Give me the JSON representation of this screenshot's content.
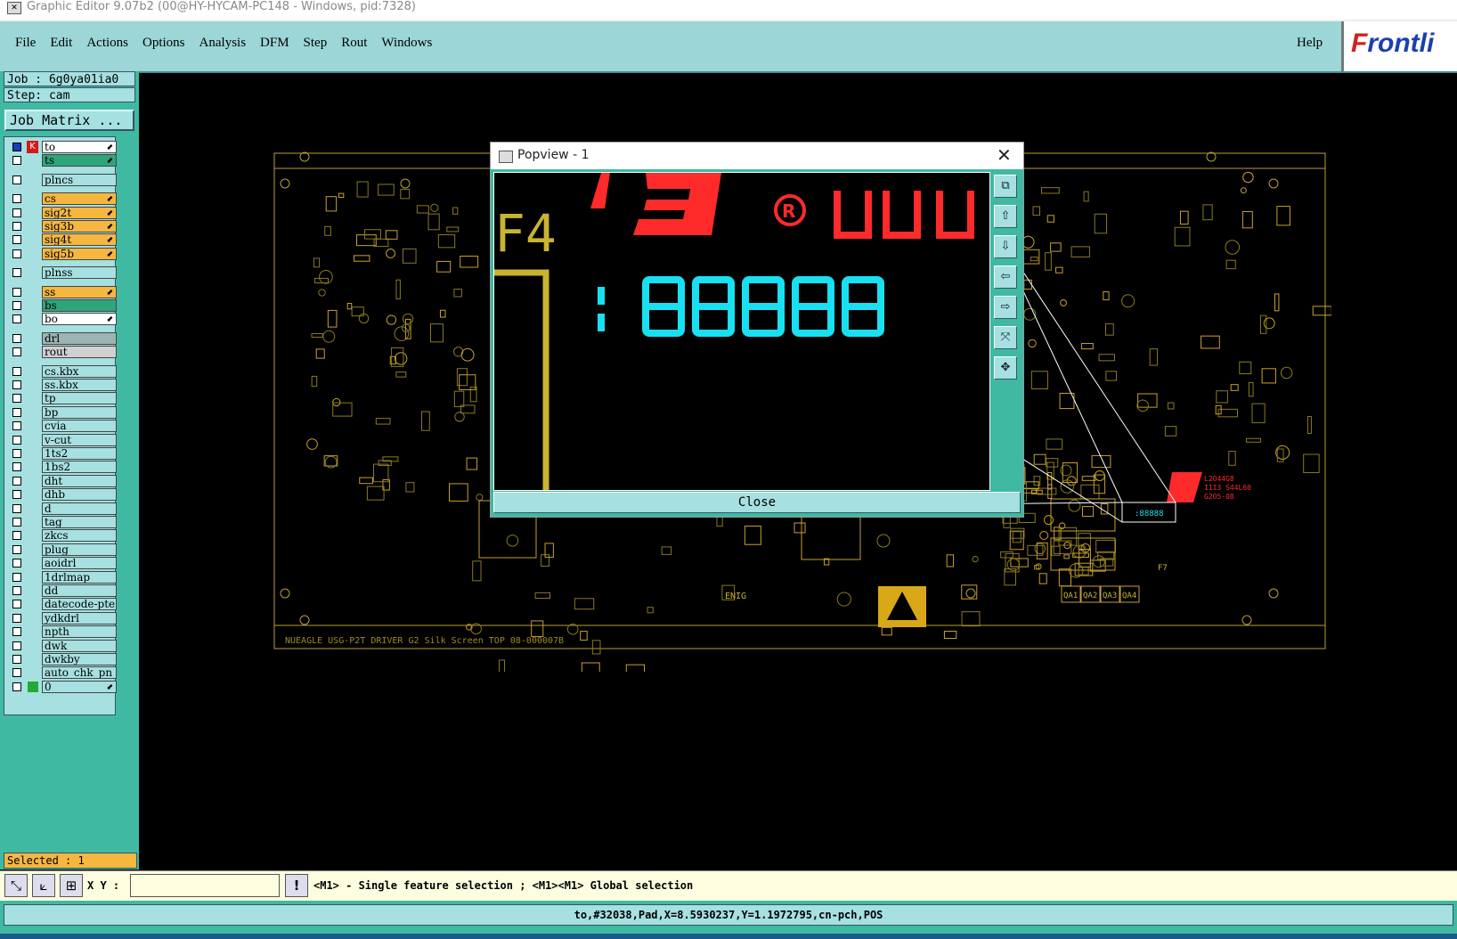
{
  "window": {
    "title": "Graphic Editor 9.07b2 (00@HY-HYCAM-PC148 - Windows, pid:7328)"
  },
  "menu": {
    "items": [
      "File",
      "Edit",
      "Actions",
      "Options",
      "Analysis",
      "DFM",
      "Step",
      "Rout",
      "Windows"
    ],
    "help": "Help",
    "brand_prefix": "F",
    "brand_rest": "rontli"
  },
  "job": {
    "job_line": "Job : 6g0ya01ia0",
    "step_line": "Step: cam",
    "matrix_button": "Job Matrix ..."
  },
  "layers": [
    {
      "name": "to",
      "color": "#ffffff",
      "arrow": true,
      "work": true
    },
    {
      "name": "ts",
      "color": "#2fa57a",
      "arrow": true
    },
    {
      "name": "plncs",
      "color": "#a6e0e0",
      "gap": true
    },
    {
      "name": "cs",
      "color": "#f5b740",
      "arrow": true,
      "gap": true
    },
    {
      "name": "sig2t",
      "color": "#f5b740",
      "arrow": true
    },
    {
      "name": "sig3b",
      "color": "#f5b740",
      "arrow": true
    },
    {
      "name": "sig4t",
      "color": "#f5b740",
      "arrow": true
    },
    {
      "name": "sig5b",
      "color": "#f5b740",
      "arrow": true
    },
    {
      "name": "plnss",
      "color": "#a6e0e0",
      "gap": true
    },
    {
      "name": "ss",
      "color": "#f5b740",
      "arrow": true,
      "gap": true
    },
    {
      "name": "bs",
      "color": "#2fa57a"
    },
    {
      "name": "bo",
      "color": "#ffffff",
      "arrow": true
    },
    {
      "name": "drl",
      "color": "#9cb4b4",
      "gap": true
    },
    {
      "name": "rout",
      "color": "#d0d0d0"
    },
    {
      "name": "cs.kbx",
      "color": "#a6e0e0",
      "gap": true
    },
    {
      "name": "ss.kbx",
      "color": "#a6e0e0"
    },
    {
      "name": "tp",
      "color": "#a6e0e0"
    },
    {
      "name": "bp",
      "color": "#a6e0e0"
    },
    {
      "name": "cvia",
      "color": "#a6e0e0"
    },
    {
      "name": "v-cut",
      "color": "#a6e0e0"
    },
    {
      "name": "1ts2",
      "color": "#a6e0e0"
    },
    {
      "name": "1bs2",
      "color": "#a6e0e0"
    },
    {
      "name": "dht",
      "color": "#a6e0e0"
    },
    {
      "name": "dhb",
      "color": "#a6e0e0"
    },
    {
      "name": "d",
      "color": "#a6e0e0"
    },
    {
      "name": "tag",
      "color": "#a6e0e0"
    },
    {
      "name": "zkcs",
      "color": "#a6e0e0"
    },
    {
      "name": "plug",
      "color": "#a6e0e0"
    },
    {
      "name": "aoidrl",
      "color": "#a6e0e0"
    },
    {
      "name": "1drlmap",
      "color": "#a6e0e0"
    },
    {
      "name": "dd",
      "color": "#a6e0e0"
    },
    {
      "name": "datecode-pte",
      "color": "#a6e0e0"
    },
    {
      "name": "ydkdrl",
      "color": "#a6e0e0"
    },
    {
      "name": "npth",
      "color": "#a6e0e0"
    },
    {
      "name": "dwk",
      "color": "#a6e0e0"
    },
    {
      "name": "dwkby",
      "color": "#a6e0e0"
    },
    {
      "name": "auto_chk_pn",
      "color": "#a6e0e0"
    },
    {
      "name": "0",
      "color": "#a6e0e0",
      "arrow": true,
      "greenbox": true
    }
  ],
  "selected": "Selected : 1",
  "coords": {
    "label": "X Y :",
    "value": ""
  },
  "hint": "<M1> - Single feature selection ; <M1><M1> Global selection",
  "status": "to,#32038,Pad,X=8.5930237,Y=1.1972795,cn-pch,POS",
  "popview": {
    "title": "Popview - 1",
    "close": "Close"
  },
  "board": {
    "caption": "NUEAGLE USG-P2T DRIVER G2 Silk Screen TOP 08-000007B",
    "enig": "ENIG",
    "f7": "F7",
    "qa": [
      "QA1",
      "QA2",
      "QA3",
      "QA4"
    ],
    "red_text": [
      "L2O44G8",
      "I1I3 S44L60",
      "G2O5-08"
    ]
  },
  "colors": {
    "accent": "#3fb9a2",
    "panel": "#a6e0e0",
    "menu": "#9cd6d6",
    "silk": "#c8b430",
    "highlight": "#ff2a2a",
    "digits": "#18e0f0"
  }
}
